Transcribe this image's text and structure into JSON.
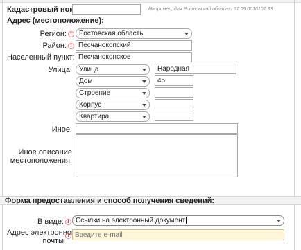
{
  "cadastral": {
    "label": "Кадастровый номер:",
    "value": "",
    "hint": "Например, для Ростовской области 61:09:0010107:33"
  },
  "address": {
    "heading": "Адрес (местоположение):",
    "region": {
      "label": "Регион:",
      "value": "Ростовская область"
    },
    "district": {
      "label": "Район:",
      "value": "Песчанокопский"
    },
    "settlement": {
      "label": "Населенный пункт:",
      "value": "Песчанокопское"
    },
    "street": {
      "label": "Улица:",
      "type": "Улица",
      "value": "Народная"
    },
    "house": {
      "type": "Дом",
      "value": "45"
    },
    "building": {
      "type": "Строение",
      "value": ""
    },
    "block": {
      "type": "Корпус",
      "value": ""
    },
    "apartment": {
      "type": "Квартира",
      "value": ""
    },
    "other": {
      "label": "Иное:",
      "value": ""
    },
    "other_desc": {
      "label_line1": "Иное описание",
      "label_line2": "местоположения:",
      "value": ""
    }
  },
  "delivery": {
    "heading": "Форма предоставления и способ получения сведений:",
    "form": {
      "label": "В виде:",
      "value": "Ссылки на электронный документ"
    },
    "email": {
      "label_line1": "Адрес электронной",
      "label_line2": "почты",
      "placeholder": "Введите e-mail"
    }
  },
  "required_mark": "!",
  "colors": {
    "border": "#a9a9a9",
    "required": "#d04040",
    "band": "#f3f3f3",
    "email_bg": "#fdf6d8"
  }
}
